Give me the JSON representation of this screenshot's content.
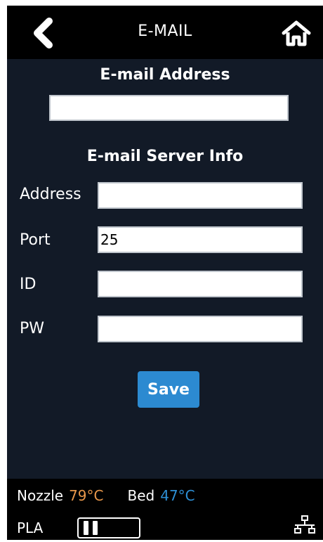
{
  "header": {
    "title": "E-MAIL",
    "back_icon": "chevron-left-icon",
    "home_icon": "home-icon"
  },
  "email": {
    "section_title": "E-mail Address",
    "address_value": ""
  },
  "server": {
    "section_title": "E-mail Server Info",
    "fields": [
      {
        "label": "Address",
        "value": ""
      },
      {
        "label": "Port",
        "value": "25"
      },
      {
        "label": "ID",
        "value": ""
      },
      {
        "label": "PW",
        "value": ""
      }
    ]
  },
  "actions": {
    "save_label": "Save"
  },
  "status": {
    "nozzle_label": "Nozzle",
    "nozzle_temp": "79°C",
    "bed_label": "Bed",
    "bed_temp": "47°C",
    "material": "PLA",
    "pause_icon": "pause-icon",
    "network_icon": "network-icon"
  },
  "colors": {
    "panel_background": "#121a27",
    "accent_button": "#2c8ad1",
    "nozzle_temp": "#e8974a",
    "bed_temp": "#2d8fd5"
  }
}
